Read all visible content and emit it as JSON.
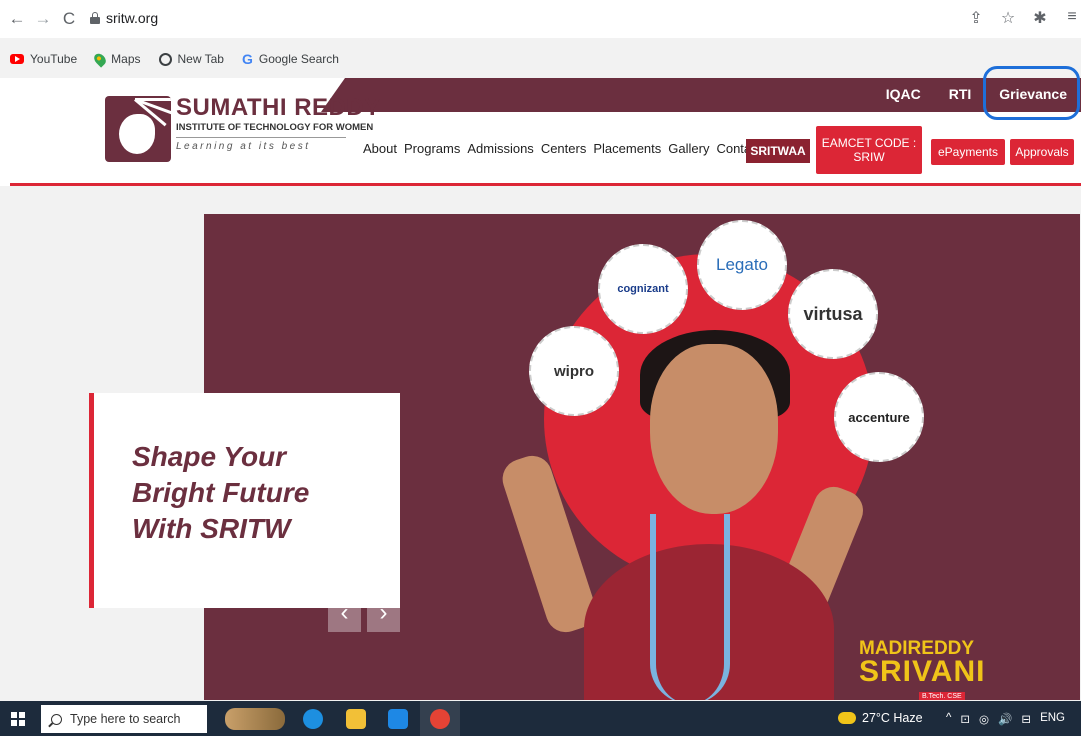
{
  "browser": {
    "url": "sritw.org",
    "bookmarks": [
      {
        "label": "YouTube"
      },
      {
        "label": "Maps"
      },
      {
        "label": "New Tab"
      },
      {
        "label": "Google Search"
      }
    ],
    "icons": {
      "back": "←",
      "forward": "→",
      "reload": "C",
      "share": "⇪",
      "star": "☆",
      "extensions": "✱",
      "menu": "≡"
    }
  },
  "site": {
    "brand": {
      "title": "SUMATHI REDDY",
      "subtitle": "INSTITUTE OF TECHNOLOGY FOR WOMEN",
      "tagline": "Learning at its best"
    },
    "top_links": [
      "IQAC",
      "RTI",
      "Grievance"
    ],
    "nav": [
      "About",
      "Programs",
      "Admissions",
      "Centers",
      "Placements",
      "Gallery",
      "Contact"
    ],
    "buttons": {
      "sritwaa": "SRITWAA",
      "eamcet_line1": "EAMCET CODE :",
      "eamcet_line2": "SRIW",
      "epayments": "ePayments",
      "approvals": "Approvals"
    },
    "colors": {
      "brand": "#6b2f3f",
      "accent": "#dc2636",
      "highlight": "#1e6fd9"
    }
  },
  "hero": {
    "headline_line1": "Shape Your",
    "headline_line2": "Bright Future",
    "headline_line3": "With SRITW",
    "recruiters": [
      "cognizant",
      "Legato",
      "virtusa",
      "wipro",
      "accenture"
    ],
    "student_first": "MADIREDDY",
    "student_last": "SRIVANI",
    "student_branch": "B.Tech. CSE",
    "prev": "‹",
    "next": "›"
  },
  "taskbar": {
    "search_placeholder": "Type here to search",
    "weather": "27°C Haze",
    "tray": [
      "^",
      "⊡",
      "◎",
      "🔊",
      "⊟",
      "ENG"
    ]
  }
}
